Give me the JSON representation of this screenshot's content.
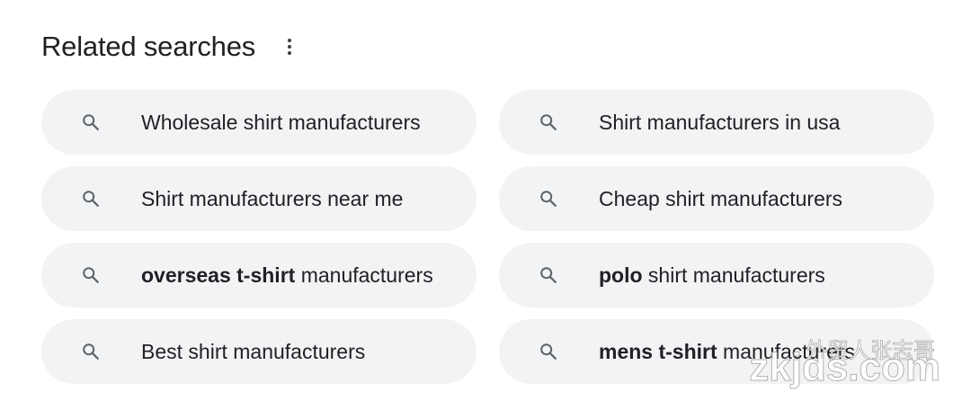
{
  "header": {
    "title": "Related searches",
    "more_icon": "more-vert-icon"
  },
  "searches": [
    {
      "bold": "",
      "rest": "Wholesale shirt manufacturers"
    },
    {
      "bold": "",
      "rest": "Shirt manufacturers in usa"
    },
    {
      "bold": "",
      "rest": "Shirt manufacturers near me"
    },
    {
      "bold": "",
      "rest": "Cheap shirt manufacturers"
    },
    {
      "bold": "overseas t-shirt",
      "rest": " manufacturers"
    },
    {
      "bold": "polo",
      "rest": " shirt manufacturers"
    },
    {
      "bold": "",
      "rest": "Best shirt manufacturers"
    },
    {
      "bold": "mens t-shirt",
      "rest": " manufacturers"
    }
  ],
  "icon": "search-icon",
  "watermark": {
    "line1": "外贸人张志哥",
    "line2": "zkjds.com"
  }
}
